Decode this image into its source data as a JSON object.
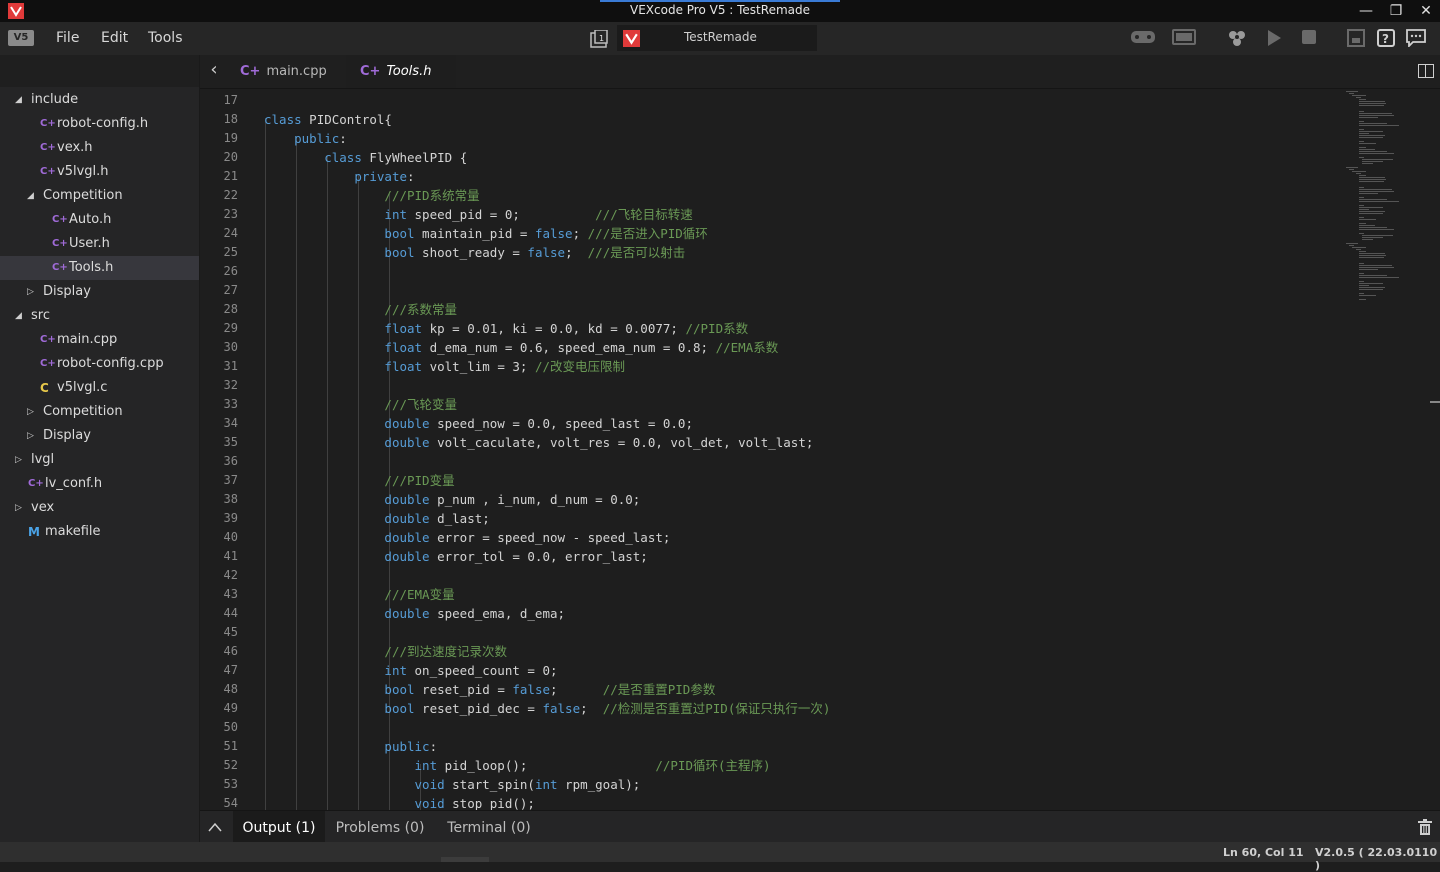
{
  "window": {
    "title": "VEXcode Pro V5 : TestRemade",
    "controls": [
      "minimize-icon",
      "restore-icon",
      "close-icon"
    ]
  },
  "menu": {
    "items": [
      "File",
      "Edit",
      "Tools"
    ],
    "project_name": "TestRemade",
    "toolbar_icons": [
      "controller-icon",
      "brain-icon",
      "download-icon",
      "play-icon",
      "stop-icon",
      "device-info-icon",
      "help-icon",
      "feedback-icon"
    ]
  },
  "sidebar": {
    "tree": [
      {
        "label": "include",
        "type": "folder",
        "expanded": true
      },
      {
        "label": "robot-config.h",
        "type": "cpp"
      },
      {
        "label": "vex.h",
        "type": "cpp"
      },
      {
        "label": "v5lvgl.h",
        "type": "cpp"
      },
      {
        "label": "Competition",
        "type": "folder",
        "expanded": true
      },
      {
        "label": "Auto.h",
        "type": "cpp"
      },
      {
        "label": "User.h",
        "type": "cpp"
      },
      {
        "label": "Tools.h",
        "type": "cpp",
        "selected": true
      },
      {
        "label": "Display",
        "type": "folder",
        "expanded": false
      },
      {
        "label": "src",
        "type": "folder",
        "expanded": true
      },
      {
        "label": "main.cpp",
        "type": "cpp"
      },
      {
        "label": "robot-config.cpp",
        "type": "cpp"
      },
      {
        "label": "v5lvgl.c",
        "type": "c"
      },
      {
        "label": "Competition",
        "type": "folder",
        "expanded": false
      },
      {
        "label": "Display",
        "type": "folder",
        "expanded": false
      },
      {
        "label": "lvgl",
        "type": "folder",
        "expanded": false
      },
      {
        "label": "lv_conf.h",
        "type": "cpp"
      },
      {
        "label": "vex",
        "type": "folder",
        "expanded": false
      },
      {
        "label": "makefile",
        "type": "make"
      }
    ]
  },
  "tabs": [
    {
      "label": "main.cpp",
      "active": false
    },
    {
      "label": "Tools.h",
      "active": true
    }
  ],
  "editor": {
    "lines": [
      {
        "n": "17",
        "code": ""
      },
      {
        "n": "18",
        "code": "class PIDControl{"
      },
      {
        "n": "19",
        "code": "    public:"
      },
      {
        "n": "20",
        "code": "        class FlyWheelPID {"
      },
      {
        "n": "21",
        "code": "            private:"
      },
      {
        "n": "22",
        "code": "                ///PID系统常量"
      },
      {
        "n": "23",
        "code": "                int speed_pid = 0;          ///飞轮目标转速"
      },
      {
        "n": "24",
        "code": "                bool maintain_pid = false; ///是否进入PID循环"
      },
      {
        "n": "25",
        "code": "                bool shoot_ready = false;  ///是否可以射击"
      },
      {
        "n": "26",
        "code": ""
      },
      {
        "n": "27",
        "code": ""
      },
      {
        "n": "28",
        "code": "                ///系数常量"
      },
      {
        "n": "29",
        "code": "                float kp = 0.01, ki = 0.0, kd = 0.0077; //PID系数"
      },
      {
        "n": "30",
        "code": "                float d_ema_num = 0.6, speed_ema_num = 0.8; //EMA系数"
      },
      {
        "n": "31",
        "code": "                float volt_lim = 3; //改变电压限制"
      },
      {
        "n": "32",
        "code": ""
      },
      {
        "n": "33",
        "code": "                ///飞轮变量"
      },
      {
        "n": "34",
        "code": "                double speed_now = 0.0, speed_last = 0.0;"
      },
      {
        "n": "35",
        "code": "                double volt_caculate, volt_res = 0.0, vol_det, volt_last;"
      },
      {
        "n": "36",
        "code": ""
      },
      {
        "n": "37",
        "code": "                ///PID变量"
      },
      {
        "n": "38",
        "code": "                double p_num , i_num, d_num = 0.0;"
      },
      {
        "n": "39",
        "code": "                double d_last;"
      },
      {
        "n": "40",
        "code": "                double error = speed_now - speed_last;"
      },
      {
        "n": "41",
        "code": "                double error_tol = 0.0, error_last;"
      },
      {
        "n": "42",
        "code": ""
      },
      {
        "n": "43",
        "code": "                ///EMA变量"
      },
      {
        "n": "44",
        "code": "                double speed_ema, d_ema;"
      },
      {
        "n": "45",
        "code": ""
      },
      {
        "n": "46",
        "code": "                ///到达速度记录次数"
      },
      {
        "n": "47",
        "code": "                int on_speed_count = 0;"
      },
      {
        "n": "48",
        "code": "                bool reset_pid = false;      //是否重置PID参数"
      },
      {
        "n": "49",
        "code": "                bool reset_pid_dec = false;  //检测是否重置过PID(保证只执行一次)"
      },
      {
        "n": "50",
        "code": ""
      },
      {
        "n": "51",
        "code": "                public:"
      },
      {
        "n": "52",
        "code": "                    int pid_loop();                 //PID循环(主程序)"
      },
      {
        "n": "53",
        "code": "                    void start_spin(int rpm_goal);"
      },
      {
        "n": "54",
        "code": "                    void stop_pid();"
      }
    ]
  },
  "panel": {
    "tabs": [
      {
        "label": "Output (1)",
        "active": true
      },
      {
        "label": "Problems (0)",
        "active": false
      },
      {
        "label": "Terminal (0)",
        "active": false
      }
    ]
  },
  "status": {
    "cursor": "Ln 60, Col 11",
    "version": "V2.0.5 ( 22.03.0110 )"
  },
  "colors": {
    "keyword": "#569cd6",
    "comment": "#6a9955",
    "text": "#d4d4d4",
    "cpp_icon": "#a06bd8",
    "c_icon": "#e7c84a",
    "make_icon": "#4aa3e7",
    "brand_red": "#e03a3a"
  }
}
